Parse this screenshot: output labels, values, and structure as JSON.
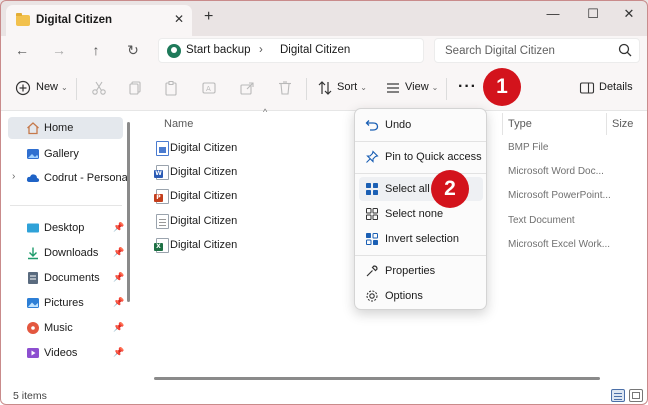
{
  "window": {
    "tab_title": "Digital Citizen",
    "new_tab": "+",
    "tab_close": "✕",
    "minimize": "—",
    "maximize": "☐",
    "close": "✕"
  },
  "navigation": {
    "back": "←",
    "forward": "→",
    "up": "↑",
    "refresh": "↻",
    "breadcrumb": [
      "Start backup",
      "Digital Citizen"
    ],
    "separator": "›",
    "search_placeholder": "Search Digital Citizen"
  },
  "toolbar": {
    "new_label": "New",
    "sort_label": "Sort",
    "view_label": "View",
    "more_label": "···",
    "details_label": "Details"
  },
  "sidebar": {
    "items": [
      {
        "label": "Home",
        "icon": "home-icon",
        "active": true
      },
      {
        "label": "Gallery",
        "icon": "gallery-icon"
      },
      {
        "label": "Codrut - Personal",
        "icon": "cloud-icon",
        "expander": "›"
      },
      {
        "label": "Desktop",
        "icon": "desktop-icon",
        "pinned": true
      },
      {
        "label": "Downloads",
        "icon": "download-icon",
        "pinned": true
      },
      {
        "label": "Documents",
        "icon": "documents-icon",
        "pinned": true
      },
      {
        "label": "Pictures",
        "icon": "pictures-icon",
        "pinned": true
      },
      {
        "label": "Music",
        "icon": "music-icon",
        "pinned": true
      },
      {
        "label": "Videos",
        "icon": "videos-icon",
        "pinned": true
      }
    ],
    "pin_glyph": "📌"
  },
  "file_list": {
    "columns": [
      "Name",
      "Type",
      "Size"
    ],
    "rows": [
      {
        "name": "Digital Citizen",
        "type": "BMP File",
        "kind": "bmp",
        "color": "#4a7bd0",
        "tag": ""
      },
      {
        "name": "Digital Citizen",
        "type": "Microsoft Word Doc...",
        "kind": "word",
        "color": "#2b5bb5",
        "tag": "W"
      },
      {
        "name": "Digital Citizen",
        "type": "Microsoft PowerPoint...",
        "kind": "ppt",
        "color": "#c43e1c",
        "tag": "P"
      },
      {
        "name": "Digital Citizen",
        "type": "Text Document",
        "kind": "txt",
        "color": "#8a8a8a",
        "tag": ""
      },
      {
        "name": "Digital Citizen",
        "type": "Microsoft Excel Work...",
        "kind": "excel",
        "color": "#1d7044",
        "tag": "X"
      }
    ]
  },
  "context_menu": {
    "items": [
      {
        "label": "Undo",
        "icon": "undo-icon"
      },
      {
        "label": "Pin to Quick access",
        "icon": "pin-icon"
      },
      {
        "label": "Select all",
        "icon": "select-all-icon",
        "hover": true
      },
      {
        "label": "Select none",
        "icon": "select-none-icon"
      },
      {
        "label": "Invert selection",
        "icon": "invert-selection-icon"
      },
      {
        "label": "Properties",
        "icon": "properties-icon"
      },
      {
        "label": "Options",
        "icon": "options-icon"
      }
    ]
  },
  "annotations": {
    "badge_1": "1",
    "badge_2": "2",
    "badge_color": "#d3131c"
  },
  "status": {
    "item_count": "5 items"
  },
  "colors": {
    "accent": "#1a5fb4",
    "title_bar": "#eae4e4",
    "toolbar": "#f9f6f6",
    "sidebar_active": "#e4e8ed"
  }
}
